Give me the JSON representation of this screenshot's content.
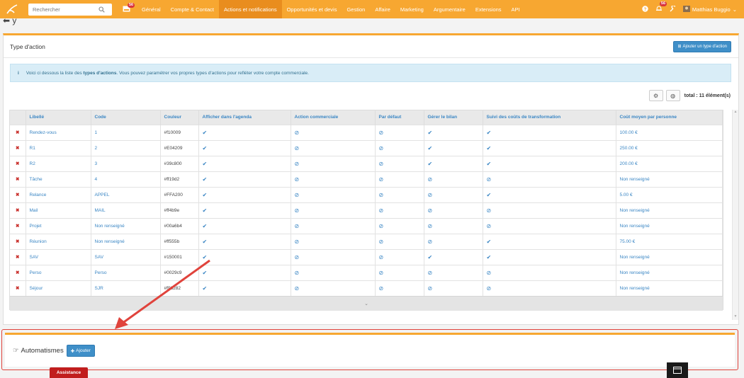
{
  "nav": {
    "search_placeholder": "Rechercher",
    "notif_badge": "56",
    "menu": [
      {
        "label": "Général",
        "active": false
      },
      {
        "label": "Compte & Contact",
        "active": false
      },
      {
        "label": "Actions et notifications",
        "active": true
      },
      {
        "label": "Opportunités et devis",
        "active": false
      },
      {
        "label": "Gestion",
        "active": false
      },
      {
        "label": "Affaire",
        "active": false
      },
      {
        "label": "Marketing",
        "active": false
      },
      {
        "label": "Argumentaire",
        "active": false
      },
      {
        "label": "Extensions",
        "active": false
      },
      {
        "label": "API",
        "active": false
      }
    ],
    "alerts_badge": "56",
    "user_name": "Matthias Buggio"
  },
  "page": {
    "title_fragment": "y",
    "panel_title": "Type d'action",
    "add_button": "Ajouter un type d'action",
    "info_prefix": "Voici ci dessous la liste des ",
    "info_bold": "types d'actions",
    "info_suffix": ". Vous pouvez paramétrer vos propres types d'actions pour refléter votre compte commerciale.",
    "total": "total : 11 élément(s)"
  },
  "table": {
    "headers": [
      "Libellé",
      "Code",
      "Couleur",
      "Afficher dans l'agenda",
      "Action commerciale",
      "Par défaut",
      "Gérer le bilan",
      "Suivi des coûts de transformation",
      "Coût moyen par personne"
    ],
    "rows": [
      {
        "label": "Rendez-vous",
        "code": "1",
        "color": "#f10009",
        "agenda": "check",
        "commercial": "none",
        "default": "none",
        "bilan": "check",
        "suivi": "check",
        "cout": "100.00 €"
      },
      {
        "label": "R1",
        "code": "2",
        "color": "#E04209",
        "agenda": "check",
        "commercial": "none",
        "default": "none",
        "bilan": "check",
        "suivi": "check",
        "cout": "250.00 €"
      },
      {
        "label": "R2",
        "code": "3",
        "color": "#39c800",
        "agenda": "check",
        "commercial": "none",
        "default": "none",
        "bilan": "check",
        "suivi": "check",
        "cout": "200.00 €"
      },
      {
        "label": "Tâche",
        "code": "4",
        "color": "#ff19d2",
        "agenda": "check",
        "commercial": "none",
        "default": "none",
        "bilan": "none",
        "suivi": "none",
        "cout": "Non renseigné"
      },
      {
        "label": "Relance",
        "code": "APPEL",
        "color": "#FFA200",
        "agenda": "check",
        "commercial": "none",
        "default": "none",
        "bilan": "none",
        "suivi": "check",
        "cout": "5.00 €"
      },
      {
        "label": "Mail",
        "code": "MAIL",
        "color": "#ff4b9e",
        "agenda": "check",
        "commercial": "none",
        "default": "none",
        "bilan": "none",
        "suivi": "none",
        "cout": "Non renseigné"
      },
      {
        "label": "Projet",
        "code": "Non renseigné",
        "color": "#00a6b4",
        "agenda": "check",
        "commercial": "none",
        "default": "none",
        "bilan": "none",
        "suivi": "none",
        "cout": "Non renseigné"
      },
      {
        "label": "Réunion",
        "code": "Non renseigné",
        "color": "#ff555b",
        "agenda": "check",
        "commercial": "none",
        "default": "none",
        "bilan": "none",
        "suivi": "check",
        "cout": "75.00 €"
      },
      {
        "label": "SAV",
        "code": "SAV",
        "color": "#150001",
        "agenda": "check",
        "commercial": "none",
        "default": "none",
        "bilan": "check",
        "suivi": "check",
        "cout": "Non renseigné"
      },
      {
        "label": "Perso",
        "code": "Perso",
        "color": "#0029c9",
        "agenda": "check",
        "commercial": "none",
        "default": "none",
        "bilan": "none",
        "suivi": "none",
        "cout": "Non renseigné"
      },
      {
        "label": "Séjour",
        "code": "SJR",
        "color": "#f9b282",
        "agenda": "check",
        "commercial": "none",
        "default": "none",
        "bilan": "none",
        "suivi": "none",
        "cout": "Non renseigné"
      }
    ]
  },
  "glyphs": {
    "delete": "✖",
    "check": "✔",
    "none": "⊘",
    "more": "⌄"
  },
  "automatismes": {
    "title": "Automatismes",
    "add_button": "Ajouter"
  },
  "footer": {
    "assistance": "Assistance"
  },
  "colors": {
    "navbar": "#f7a731",
    "navbar_active": "#e98d1e",
    "link": "#3a86c4",
    "button": "#3f8fc8",
    "delete": "#c9302c",
    "annotation": "#e0433c",
    "assistance": "#c11d1d"
  }
}
